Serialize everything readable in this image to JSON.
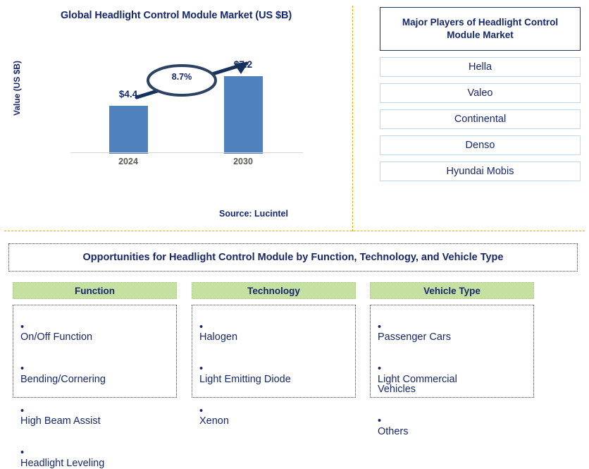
{
  "chart_data": {
    "type": "bar",
    "title": "Global Headlight Control Module Market (US $B)",
    "xlabel": "",
    "ylabel": "Value (US $B)",
    "categories": [
      "2024",
      "2030"
    ],
    "values": [
      4.4,
      7.2
    ],
    "value_labels": [
      "$4.4",
      "$7.2"
    ],
    "ylim": [
      0,
      8
    ],
    "grid": false,
    "legend": null,
    "annotation": "8.7%",
    "annotation_meaning": "CAGR growth arrow from 2024 bar to 2030 bar",
    "bar_color": "#4f81bd",
    "source": "Source: Lucintel"
  },
  "chart_panel": {
    "title": "Global Headlight Control Module Market (US $B)",
    "y_axis_title": "Value (US $B)",
    "bars": [
      {
        "category": "2024",
        "value_label": "$4.4"
      },
      {
        "category": "2030",
        "value_label": "$7.2"
      }
    ],
    "cagr_label": "8.7%",
    "source": "Source: Lucintel"
  },
  "players_panel": {
    "header": "Major Players of Headlight Control Module Market",
    "players": [
      {
        "name": "Hella"
      },
      {
        "name": "Valeo"
      },
      {
        "name": "Continental"
      },
      {
        "name": "Denso"
      },
      {
        "name": "Hyundai Mobis"
      }
    ]
  },
  "opportunities": {
    "title": "Opportunities for Headlight Control Module by Function, Technology, and Vehicle Type",
    "columns": [
      {
        "heading": "Function",
        "items": [
          "On/Off Function",
          "Bending/Cornering",
          "High Beam Assist",
          "Headlight Leveling"
        ]
      },
      {
        "heading": "Technology",
        "items": [
          "Halogen",
          "Light Emitting Diode",
          "Xenon"
        ]
      },
      {
        "heading": "Vehicle Type",
        "items": [
          "Passenger Cars",
          "Light Commercial\nVehicles",
          "Others"
        ]
      }
    ]
  },
  "colors": {
    "navy": "#16286b",
    "bar_blue": "#4f81bd",
    "divider_gold": "#f0a500",
    "header_green": "#c6e0a2",
    "player_border_blue": "#bdd7ee",
    "tick_gray": "#5a5a52"
  }
}
